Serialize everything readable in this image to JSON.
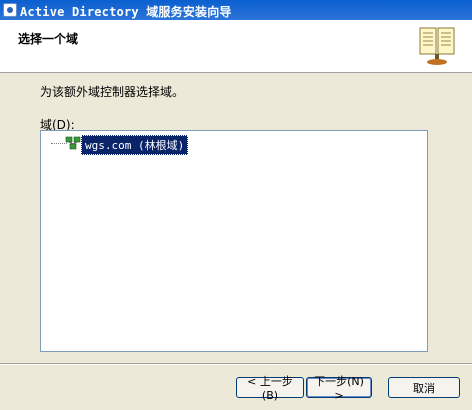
{
  "window": {
    "title": "Active Directory 域服务安装向导"
  },
  "header": {
    "title": "选择一个域",
    "icon": "open-book-icon"
  },
  "content": {
    "instruction": "为该额外域控制器选择域。",
    "domain_label": "域(D):",
    "tree": {
      "items": [
        {
          "label": "wgs.com (林根域)",
          "icon": "domain-tree-icon",
          "selected": true
        }
      ]
    }
  },
  "buttons": {
    "back_label": "< 上一步(B)",
    "next_label": "下一步(N) >",
    "cancel_label": "取消"
  },
  "colors": {
    "title_bar": "#0a5fcf",
    "selection": "#0a246a",
    "dialog_bg": "#ece9d8"
  }
}
